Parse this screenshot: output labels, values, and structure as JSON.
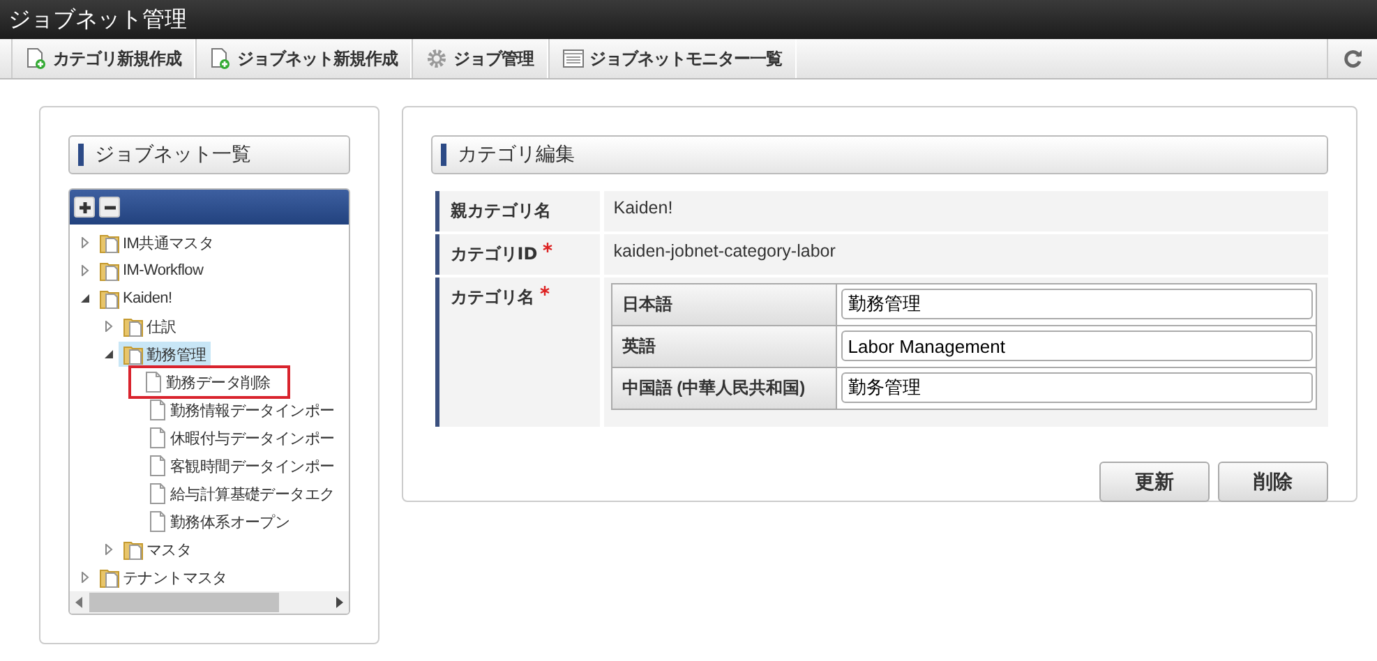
{
  "window": {
    "title": "ジョブネット管理"
  },
  "toolbar": {
    "items": [
      {
        "label": "カテゴリ新規作成",
        "kind": "new"
      },
      {
        "label": "ジョブネット新規作成",
        "kind": "new"
      },
      {
        "label": "ジョブ管理",
        "kind": "gear"
      },
      {
        "label": "ジョブネットモニター一覧",
        "kind": "list"
      }
    ]
  },
  "jobnet_list": {
    "title": "ジョブネット一覧",
    "tree": [
      {
        "label": "IM共通マスタ",
        "kind": "folder",
        "expanded": false,
        "selected": false,
        "marked": false
      },
      {
        "label": "IM-Workflow",
        "kind": "folder",
        "expanded": false,
        "selected": false,
        "marked": false
      },
      {
        "label": "Kaiden!",
        "kind": "folder",
        "expanded": true,
        "selected": false,
        "marked": false,
        "children": [
          {
            "label": "仕訳",
            "kind": "folder",
            "expanded": false,
            "selected": false,
            "marked": false
          },
          {
            "label": "勤務管理",
            "kind": "folder",
            "expanded": true,
            "selected": true,
            "marked": false,
            "children": [
              {
                "label": "勤務データ削除",
                "kind": "document",
                "selected": false,
                "marked": true
              },
              {
                "label": "勤務情報データインポー",
                "kind": "document",
                "selected": false,
                "marked": false
              },
              {
                "label": "休暇付与データインポー",
                "kind": "document",
                "selected": false,
                "marked": false
              },
              {
                "label": "客観時間データインポー",
                "kind": "document",
                "selected": false,
                "marked": false
              },
              {
                "label": "給与計算基礎データエク",
                "kind": "document",
                "selected": false,
                "marked": false
              },
              {
                "label": "勤務体系オープン",
                "kind": "document",
                "selected": false,
                "marked": false
              }
            ]
          },
          {
            "label": "マスタ",
            "kind": "folder",
            "expanded": false,
            "selected": false,
            "marked": false
          }
        ]
      },
      {
        "label": "テナントマスタ",
        "kind": "folder",
        "expanded": false,
        "selected": false,
        "marked": false
      }
    ]
  },
  "category_edit": {
    "title": "カテゴリ編集",
    "fields": [
      {
        "label": "親カテゴリ名",
        "required": false,
        "value": "Kaiden!"
      },
      {
        "label": "カテゴリID",
        "required": true,
        "value": "kaiden-jobnet-category-labor"
      }
    ],
    "name_field": {
      "label": "カテゴリ名",
      "required": true,
      "locales": [
        {
          "language": "日本語",
          "value": "勤務管理"
        },
        {
          "language": "英語",
          "value": "Labor Management"
        },
        {
          "language": "中国語 (中華人民共和国)",
          "value": "勤务管理"
        }
      ]
    },
    "buttons": [
      "更新",
      "削除"
    ]
  }
}
